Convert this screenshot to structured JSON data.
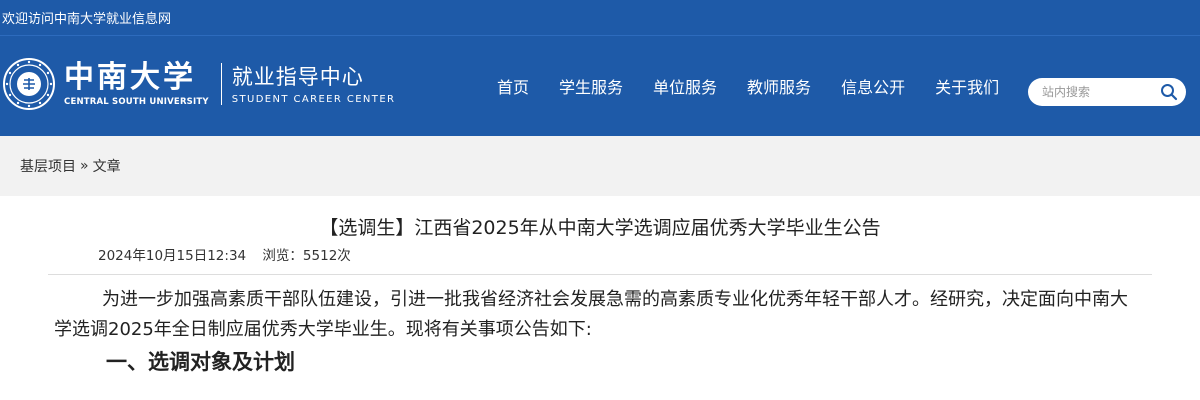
{
  "topbar": {
    "welcome": "欢迎访问中南大学就业信息网"
  },
  "header": {
    "university_cn": "中南大学",
    "university_en": "CENTRAL SOUTH UNIVERSITY",
    "center_cn": "就业指导中心",
    "center_en": "STUDENT CAREER CENTER",
    "brand_color": "#1e5aa8"
  },
  "nav": {
    "items": [
      {
        "label": "首页"
      },
      {
        "label": "学生服务"
      },
      {
        "label": "单位服务"
      },
      {
        "label": "教师服务"
      },
      {
        "label": "信息公开"
      },
      {
        "label": "关于我们"
      }
    ]
  },
  "search": {
    "placeholder": "站内搜索",
    "value": ""
  },
  "breadcrumb": {
    "items": [
      "基层项目",
      "文章"
    ],
    "separator": "»"
  },
  "article": {
    "title": "【选调生】江西省2025年从中南大学选调应届优秀大学毕业生公告",
    "date": "2024年10月15日12:34",
    "views": "浏览：5512次",
    "intro": "为进一步加强高素质干部队伍建设，引进一批我省经济社会发展急需的高素质专业化优秀年轻干部人才。经研究，决定面向中南大学选调2025年全日制应届优秀大学毕业生。现将有关事项公告如下:",
    "section1_heading": "一、选调对象及计划"
  }
}
